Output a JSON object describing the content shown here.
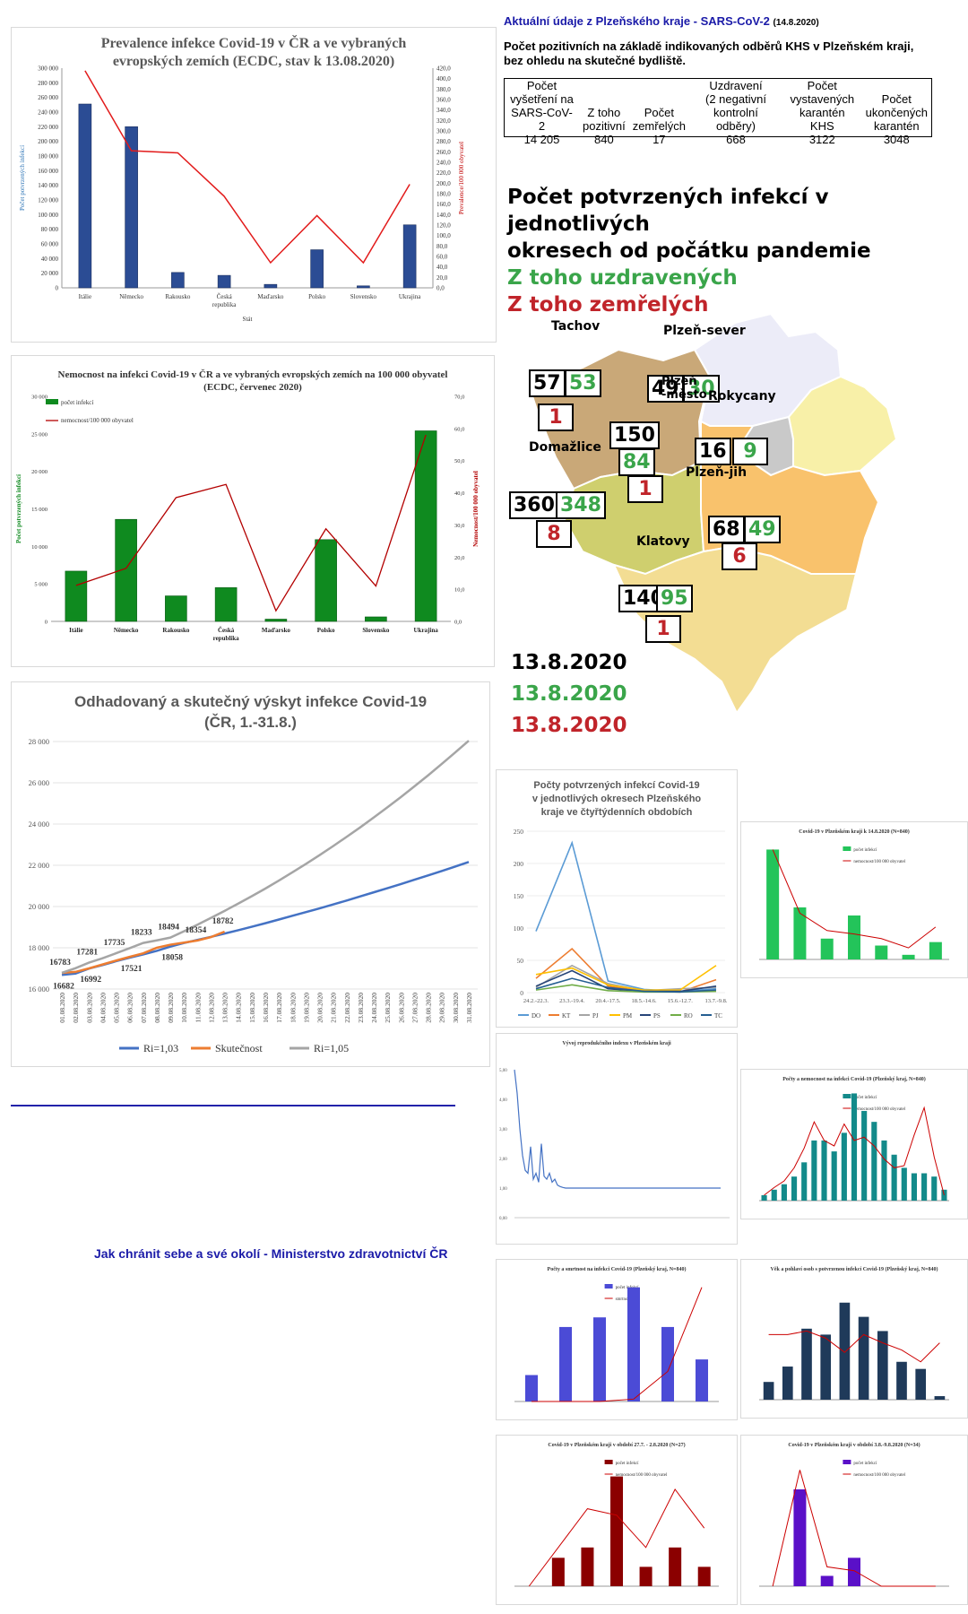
{
  "chart_data": [
    {
      "type": "bar",
      "title": "Prevalence infekce Covid-19 v ČR a ve vybraných evropských zemích (ECDC, stav k 13.08.2020)",
      "title_lines": [
        "Prevalence infekce Covid-19 v ČR a ve vybraných",
        "evropských zemích (ECDC, stav k 13.08.2020)"
      ],
      "xlabel": "Stát",
      "ylabel": "Počet potvrzených infekcí",
      "y2label": "Prevalence/100 000 obyvatel",
      "categories": [
        "Itálie",
        "Německo",
        "Rakousko",
        "Česká republika",
        "Maďarsko",
        "Polsko",
        "Slovensko",
        "Ukrajina"
      ],
      "series": [
        {
          "name": "",
          "type": "bar",
          "values": [
            251000,
            220000,
            21000,
            17000,
            4700,
            52000,
            2700,
            86000
          ]
        },
        {
          "name": "",
          "type": "line",
          "axis": "right",
          "values": [
            415,
            262,
            258,
            175,
            48,
            138,
            48,
            198
          ]
        }
      ],
      "ylim": [
        0,
        300000
      ],
      "y2lim": [
        0,
        420
      ],
      "yticks": [
        "0",
        "20 000",
        "40 000",
        "60 000",
        "80 000",
        "100 000",
        "120 000",
        "140 000",
        "160 000",
        "180 000",
        "200 000",
        "220 000",
        "240 000",
        "260 000",
        "280 000",
        "300 000"
      ],
      "y2ticks": [
        "0,0",
        "20,0",
        "40,0",
        "60,0",
        "80,0",
        "100,0",
        "120,0",
        "140,0",
        "160,0",
        "180,0",
        "200,0",
        "220,0",
        "240,0",
        "260,0",
        "280,0",
        "300,0",
        "320,0",
        "340,0",
        "360,0",
        "380,0",
        "400,0",
        "420,0"
      ],
      "colors": {
        "bar": "#2b4c94",
        "line": "#e21b1b",
        "title": "#595959"
      }
    },
    {
      "type": "bar",
      "title": "Nemocnost na infekci Covid-19 v ČR a ve vybraných evropských zemích na 100 000 obyvatel (ECDC, červenec 2020)",
      "title_lines": [
        "Nemocnost na infekci Covid-19 v ČR a ve vybraných evropských zemích na 100 000 obyvatel",
        "(ECDC, červenec 2020)"
      ],
      "ylabel": "Počet potvrzených infekcí",
      "y2label": "Nemocnost/100 000 obyvatel",
      "legend": [
        "počet infekcí",
        "nemocnost/100 000 obyvatel"
      ],
      "legend_position": "top-left",
      "categories": [
        "Itálie",
        "Německo",
        "Rakousko",
        "Česká republika",
        "Maďarsko",
        "Polsko",
        "Slovensko",
        "Ukrajina"
      ],
      "series": [
        {
          "name": "počet infekcí",
          "type": "bar",
          "values": [
            6700,
            13600,
            3400,
            4500,
            300,
            10900,
            600,
            25400
          ]
        },
        {
          "name": "nemocnost/100 000 obyvatel",
          "type": "line",
          "axis": "right",
          "values": [
            11.2,
            16.5,
            38.5,
            42.6,
            3.3,
            28.8,
            11.0,
            58.0
          ]
        }
      ],
      "ylim": [
        0,
        30000
      ],
      "y2lim": [
        0,
        70
      ],
      "yticks": [
        "0",
        "5 000",
        "10 000",
        "15 000",
        "20 000",
        "25 000",
        "30 000"
      ],
      "y2ticks": [
        "0,0",
        "10,0",
        "20,0",
        "30,0",
        "40,0",
        "50,0",
        "60,0",
        "70,0"
      ],
      "colors": {
        "bar": "#0f8a1f",
        "line": "#b30000"
      }
    },
    {
      "type": "line",
      "title": "Odhadovaný a skutečný výskyt infekce Covid-19 (ČR, 1.-31.8.)",
      "title_lines": [
        "Odhadovaný a skutečný výskyt infekce Covid-19",
        "(ČR, 1.-31.8.)"
      ],
      "x": [
        "01.08.2020",
        "02.08.2020",
        "03.08.2020",
        "04.08.2020",
        "05.08.2020",
        "06.08.2020",
        "07.08.2020",
        "08.08.2020",
        "09.08.2020",
        "10.08.2020",
        "11.08.2020",
        "12.08.2020",
        "13.08.2020",
        "14.08.2020",
        "15.08.2020",
        "16.08.2020",
        "17.08.2020",
        "18.08.2020",
        "19.08.2020",
        "20.08.2020",
        "21.08.2020",
        "22.08.2020",
        "23.08.2020",
        "24.08.2020",
        "25.08.2020",
        "26.08.2020",
        "27.08.2020",
        "28.08.2020",
        "29.08.2020",
        "30.08.2020",
        "31.08.2020"
      ],
      "series": [
        {
          "name": "Ri=1,03",
          "color": "#4472c4",
          "values": [
            16682,
            16750,
            16992,
            17160,
            17350,
            17521,
            17680,
            17850,
            18058,
            18230,
            18380,
            18530,
            18690,
            18850,
            19020,
            19190,
            19370,
            19550,
            19730,
            19910,
            20100,
            20290,
            20490,
            20690,
            20890,
            21090,
            21300,
            21510,
            21720,
            21940,
            22160
          ]
        },
        {
          "name": "Skutečnost",
          "color": "#ed7d31",
          "values": [
            16782,
            16830,
            17000,
            17190,
            17380,
            17560,
            17730,
            18000,
            18150,
            18250,
            18354,
            18520,
            18782
          ]
        },
        {
          "name": "Ri=1,05",
          "color": "#a5a5a5",
          "values": [
            16783,
            17010,
            17281,
            17490,
            17735,
            17980,
            18233,
            18360,
            18494,
            18800,
            19120,
            19450,
            19790,
            20140,
            20500,
            20870,
            21260,
            21660,
            22070,
            22490,
            22930,
            23380,
            23840,
            24320,
            24810,
            25310,
            25830,
            26360,
            26910,
            27470,
            28040
          ]
        }
      ],
      "data_labels": [
        {
          "label": "16682",
          "series": "Ri=1,03",
          "index": 0
        },
        {
          "label": "16992",
          "series": "Ri=1,03",
          "index": 2
        },
        {
          "label": "17521",
          "series": "Ri=1,03",
          "index": 5
        },
        {
          "label": "18058",
          "series": "Ri=1,03",
          "index": 8
        },
        {
          "label": "18354",
          "series": "Skutečnost",
          "index": 10
        },
        {
          "label": "18782",
          "series": "Skutečnost",
          "index": 12
        },
        {
          "label": "16783",
          "series": "Ri=1,05",
          "index": 0
        },
        {
          "label": "17281",
          "series": "Ri=1,05",
          "index": 2
        },
        {
          "label": "17735",
          "series": "Ri=1,05",
          "index": 4
        },
        {
          "label": "18233",
          "series": "Ri=1,05",
          "index": 6
        },
        {
          "label": "18494",
          "series": "Ri=1,05",
          "index": 8
        }
      ],
      "ylim": [
        16000,
        28000
      ],
      "yticks": [
        "16 000",
        "18 000",
        "20 000",
        "22 000",
        "24 000",
        "26 000",
        "28 000"
      ],
      "legend": [
        "Ri=1,03",
        "Skutečnost",
        "Ri=1,05"
      ],
      "legend_position": "bottom"
    },
    {
      "type": "line",
      "title": "Počty potvrzených infekcí Covid-19 v jednotlivých okresech Plzeňského kraje ve čtyřtýdenních obdobích",
      "title_lines": [
        "Počty potvrzených infekcí Covid-19",
        "v jednotlivých okresech Plzeňského",
        "kraje ve čtyřtýdenních obdobích"
      ],
      "categories": [
        "24.2.-22.3.",
        "23.3.-19.4.",
        "20.4.-17.5.",
        "18.5.-14.6.",
        "15.6.-12.7.",
        "13.7.-9.8."
      ],
      "series": [
        {
          "name": "DO",
          "color": "#5b9bd5",
          "values": [
            95,
            232,
            18,
            5,
            2,
            6
          ]
        },
        {
          "name": "KT",
          "color": "#ed7d31",
          "values": [
            22,
            68,
            10,
            2,
            1,
            20
          ]
        },
        {
          "name": "PJ",
          "color": "#a5a5a5",
          "values": [
            8,
            42,
            14,
            3,
            6,
            8
          ]
        },
        {
          "name": "PM",
          "color": "#ffc000",
          "values": [
            28,
            38,
            12,
            4,
            4,
            42
          ]
        },
        {
          "name": "PS",
          "color": "#264478",
          "values": [
            10,
            34,
            6,
            2,
            2,
            10
          ]
        },
        {
          "name": "RO",
          "color": "#70ad47",
          "values": [
            4,
            12,
            3,
            1,
            1,
            2
          ]
        },
        {
          "name": "TC",
          "color": "#255e91",
          "values": [
            6,
            22,
            8,
            2,
            1,
            4
          ]
        }
      ],
      "ylim": [
        0,
        250
      ],
      "yticks": [
        "0",
        "50",
        "100",
        "150",
        "200",
        "250"
      ]
    }
  ],
  "header": {
    "link_title": "Aktuální údaje z Plzeňského kraje - SARS-CoV-2",
    "date": "(14.8.2020)",
    "subtitle_lines": [
      "Počet pozitivních na základě indikovaných odběrů KHS v Plzeňském kraji,",
      "bez ohledu na skutečné bydliště."
    ]
  },
  "stats": {
    "columns": [
      {
        "label_lines": [
          "Počet",
          "vyšetření na",
          "SARS-CoV-2"
        ],
        "value": "14 205"
      },
      {
        "label_lines": [
          "Z toho",
          "pozitivní"
        ],
        "value": "840"
      },
      {
        "label_lines": [
          "Počet",
          "zemřelých"
        ],
        "value": "17"
      },
      {
        "label_lines": [
          "Uzdravení",
          "(2 negativní",
          "kontrolní odběry)"
        ],
        "value": "668"
      },
      {
        "label_lines": [
          "Počet",
          "vystavených",
          "karantén KHS"
        ],
        "value": "3122"
      },
      {
        "label_lines": [
          "Počet",
          "ukončených",
          "karantén"
        ],
        "value": "3048"
      }
    ]
  },
  "map": {
    "title_lines": [
      "Počet potvrzených infekcí v jednotlivých",
      "okresech od počátku pandemie"
    ],
    "recovered_title": "Z toho uzdravených",
    "deceased_title": "Z toho zemřelých",
    "dates": [
      "13.8.2020",
      "13.8.2020",
      "13.8.2020"
    ],
    "colors": {
      "recovered": "#3aa54a",
      "deceased": "#c0242a",
      "cases": "#000000"
    },
    "districts": [
      {
        "name": "Tachov",
        "cases": "57",
        "recovered": "53",
        "deaths": "1",
        "fill": "#c9a878"
      },
      {
        "name": "Plzeň-sever",
        "cases": "49",
        "recovered": "30",
        "deaths": "",
        "fill": "#ececf8"
      },
      {
        "name": "Rokycany",
        "cases": "16",
        "recovered": "9",
        "deaths": "",
        "fill": "#f8f0a8"
      },
      {
        "name": "Plzeň-město",
        "name_lines": [
          "Plzeň",
          "-město"
        ],
        "cases": "150",
        "recovered": "84",
        "deaths": "1",
        "fill": "#c9c9c9"
      },
      {
        "name": "Domažlice",
        "cases": "360",
        "recovered": "348",
        "deaths": "8",
        "fill": "#cfcf6e"
      },
      {
        "name": "Plzeň-jih",
        "cases": "68",
        "recovered": "49",
        "deaths": "6",
        "fill": "#f9c26c"
      },
      {
        "name": "Klatovy",
        "cases": "140",
        "recovered": "95",
        "deaths": "1",
        "fill": "#f3dd93"
      }
    ]
  },
  "bottom_link": "Jak chránit sebe a své okolí - Ministerstvo zdravotnictví ČR",
  "thumbnails": [
    {
      "title": "Covid-19 v Plzeňském kraji k 14.8.2020 (N=840)",
      "legend": [
        "počet infekcí",
        "nemocnost/100 000 obyvatel"
      ],
      "color": "#23c45a",
      "values": [
        0.95,
        0.45,
        0.18,
        0.38,
        0.12,
        0.04,
        0.15
      ],
      "line": [
        0.95,
        0.4,
        0.25,
        0.22,
        0.18,
        0.1,
        0.28
      ]
    },
    {
      "title": "Vývoj reprodukčního indexu v Plzeňském kraji",
      "y2ticks": [
        "0,00",
        "1,00",
        "2,00",
        "3,00",
        "4,00",
        "5,00"
      ]
    },
    {
      "title": "Počty a nemocnost na infekci Covid-19 (Plzeňský kraj, N=840)",
      "legend": [
        "počet infekcí",
        "nemocnost/100 000 obyvatel"
      ],
      "color": "#138a8a"
    },
    {
      "title": "Počty a smrtnost na infekci Covid-19 (Plzeňský kraj, N=840)",
      "legend": [
        "počet infekcí",
        "smrtnost (%)"
      ],
      "color": "#4b4bd6"
    },
    {
      "title": "Věk a pohlaví osob s potvrzenou infekcí Covid-19 (Plzeňský kraj, N=840)",
      "color": "#1f3a5a"
    },
    {
      "title": "Covid-19 v Plzeňském kraji v období 27.7. - 2.8.2020 (N=27)",
      "legend": [
        "počet infekcí",
        "nemocnost/100 000 obyvatel"
      ],
      "color": "#8b0000"
    },
    {
      "title": "Covid-19 v Plzeňském kraji v období 3.8.-9.8.2020 (N=34)",
      "legend": [
        "počet infekcí",
        "nemocnost/100 000 obyvatel"
      ],
      "color": "#5a10c8"
    }
  ]
}
